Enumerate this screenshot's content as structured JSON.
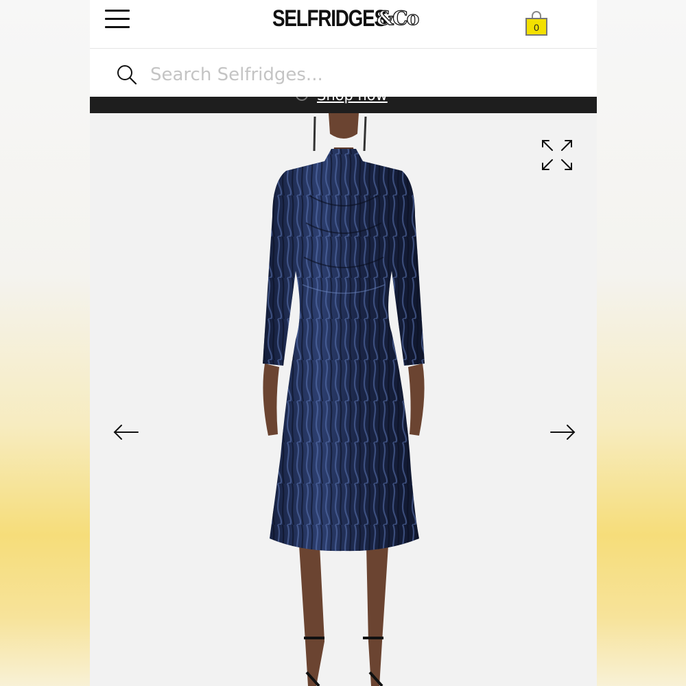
{
  "header": {
    "menu_icon": "hamburger-menu-icon",
    "logo_text": "SELFRIDGES",
    "logo_suffix": "&Co",
    "bag_icon": "shopping-bag-icon",
    "bag_count": "0",
    "bag_color": "#f3e000"
  },
  "search": {
    "icon": "search-icon",
    "placeholder": "Search Selfridges..."
  },
  "promo": {
    "link_text": "Shop now"
  },
  "gallery": {
    "image": "model-wearing-navy-velvet-midi-dress",
    "expand_icon": "expand-arrows-icon",
    "prev_icon": "arrow-left-icon",
    "next_icon": "arrow-right-icon"
  },
  "colors": {
    "dress": "#1d2a4e",
    "skin": "#6b4431",
    "background": "#f2f2f2"
  }
}
